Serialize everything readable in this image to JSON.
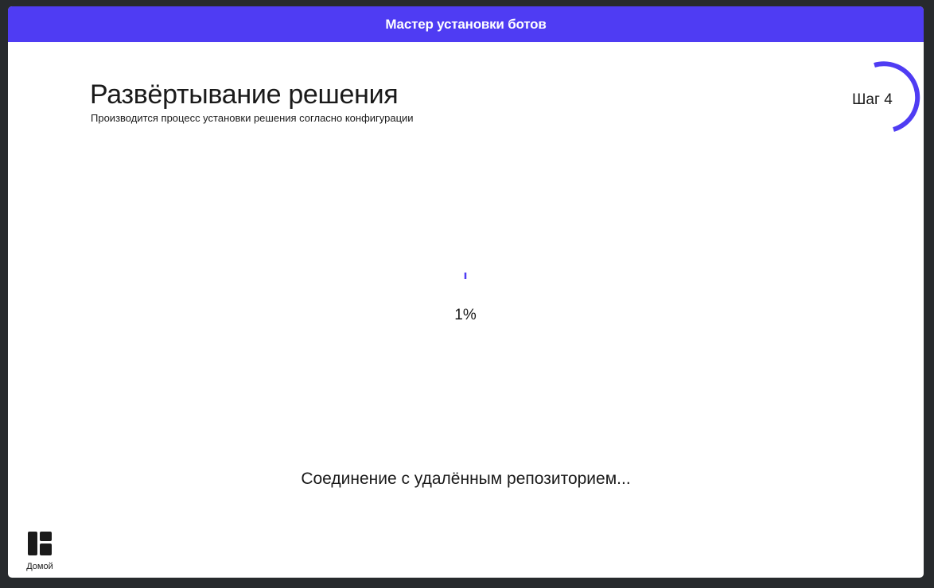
{
  "window": {
    "title": "Мастер установки ботов"
  },
  "header": {
    "title": "Развёртывание решения",
    "subtitle": "Производится процесс установки решения согласно конфигурации"
  },
  "step": {
    "label": "Шаг 4"
  },
  "progress": {
    "value": 0.01,
    "label": "1%"
  },
  "status": {
    "text": "Соединение с удалённым репозиторием..."
  },
  "sidebar": {
    "home_label": "Домой",
    "home_icon": "dashboard-icon"
  },
  "colors": {
    "accent": "#4f3cf3",
    "background": "#272a2d",
    "text": "#1a1a1a"
  }
}
